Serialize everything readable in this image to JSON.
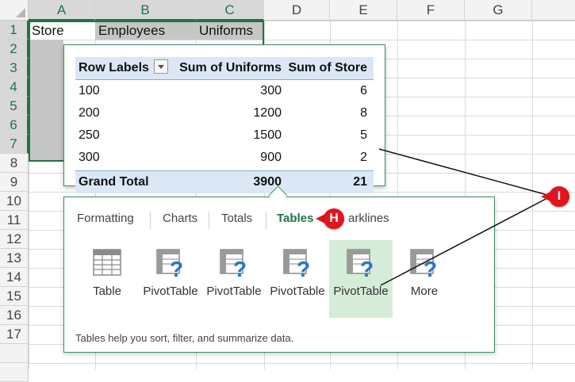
{
  "sheet": {
    "columns": [
      "A",
      "B",
      "C",
      "D",
      "E",
      "F",
      "G"
    ],
    "rows": [
      "1",
      "2",
      "3",
      "4",
      "5",
      "6",
      "7",
      "8",
      "9",
      "10",
      "11",
      "12",
      "13",
      "14",
      "15",
      "16",
      "17"
    ],
    "cells": {
      "a1": "Store",
      "b1": "Employees",
      "c1": "Uniforms"
    }
  },
  "pivot": {
    "headers": [
      "Row Labels",
      "Sum of Uniforms",
      "Sum of Store"
    ],
    "rows": [
      [
        "100",
        "300",
        "6"
      ],
      [
        "200",
        "1200",
        "8"
      ],
      [
        "250",
        "1500",
        "5"
      ],
      [
        "300",
        "900",
        "2"
      ]
    ],
    "total": [
      "Grand Total",
      "3900",
      "21"
    ]
  },
  "quick_analysis": {
    "tabs": [
      "Formatting",
      "Charts",
      "Totals",
      "Tables",
      "arklines"
    ],
    "active_tab": "Tables",
    "tools": [
      {
        "label": "Table",
        "icon": "table-icon"
      },
      {
        "label": "PivotTable",
        "icon": "pivottable-icon"
      },
      {
        "label": "PivotTable",
        "icon": "pivottable-icon"
      },
      {
        "label": "PivotTable",
        "icon": "pivottable-icon"
      },
      {
        "label": "PivotTable",
        "icon": "pivottable-icon"
      },
      {
        "label": "More",
        "icon": "pivottable-icon"
      }
    ],
    "description": "Tables help you sort, filter, and summarize data."
  },
  "callouts": {
    "h": "H",
    "i": "I"
  },
  "colors": {
    "accent": "#217346",
    "callout": "#e4141c",
    "pivot_header": "#dbe7f5",
    "highlight": "#d5ecd9"
  }
}
